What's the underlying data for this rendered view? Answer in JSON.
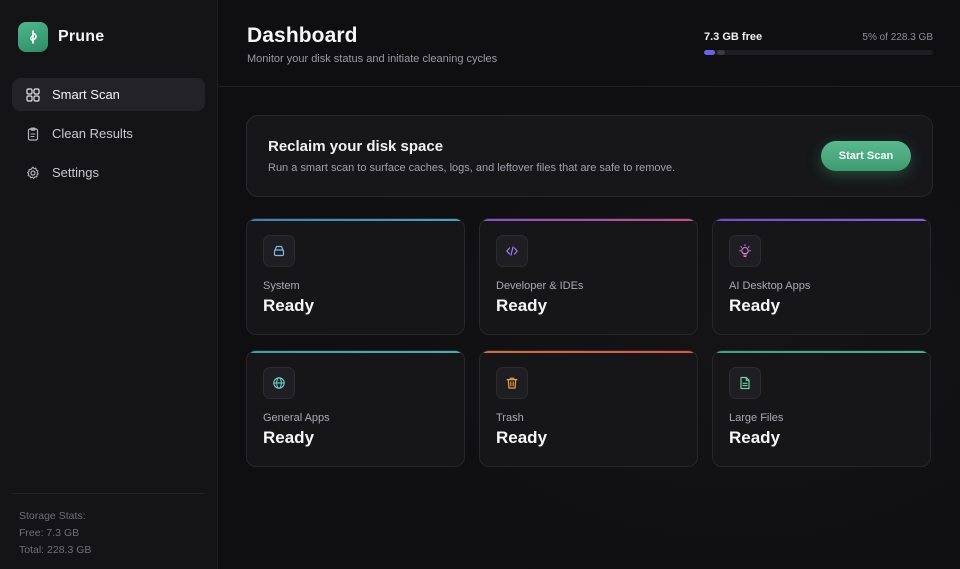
{
  "app": {
    "name": "Prune"
  },
  "sidebar": {
    "items": [
      {
        "label": "Smart Scan",
        "icon": "grid-icon",
        "active": true
      },
      {
        "label": "Clean Results",
        "icon": "clipboard-icon",
        "active": false
      },
      {
        "label": "Settings",
        "icon": "gear-icon",
        "active": false
      }
    ],
    "storage": {
      "title": "Storage Stats:",
      "free": "Free: 7.3 GB",
      "total": "Total: 228.3 GB"
    }
  },
  "header": {
    "title": "Dashboard",
    "subtitle": "Monitor your disk status and initiate cleaning cycles",
    "disk": {
      "free_label": "7.3 GB free",
      "usage_label": "5% of 228.3 GB",
      "fill_fraction": 0.05,
      "fill_color": "#6a63e6"
    }
  },
  "hero": {
    "title": "Reclaim your disk space",
    "description": "Run a smart scan to surface caches, logs, and leftover files that are safe to remove.",
    "button_label": "Start Scan"
  },
  "categories": [
    {
      "label": "System",
      "status": "Ready",
      "icon": "drive-icon",
      "accent": [
        "#3d7fb8",
        "#4aa3c8"
      ],
      "icon_color": "#7fb8e0"
    },
    {
      "label": "Developer & IDEs",
      "status": "Ready",
      "icon": "code-icon",
      "accent": [
        "#8a4fd0",
        "#c84f8a"
      ],
      "icon_color": "#9d7ff0"
    },
    {
      "label": "AI Desktop Apps",
      "status": "Ready",
      "icon": "lightbulb-icon",
      "accent": [
        "#6a4fd0",
        "#8a5fe0"
      ],
      "icon_color": "#d57fd8"
    },
    {
      "label": "General Apps",
      "status": "Ready",
      "icon": "globe-icon",
      "accent": [
        "#3f9fb0",
        "#4ab0a8"
      ],
      "icon_color": "#6fc8c0"
    },
    {
      "label": "Trash",
      "status": "Ready",
      "icon": "trash-icon",
      "accent": [
        "#d0703f",
        "#e0504f"
      ],
      "icon_color": "#e8a04f"
    },
    {
      "label": "Large Files",
      "status": "Ready",
      "icon": "file-icon",
      "accent": [
        "#3fa07f",
        "#4ab08f"
      ],
      "icon_color": "#6fd0a8"
    }
  ]
}
